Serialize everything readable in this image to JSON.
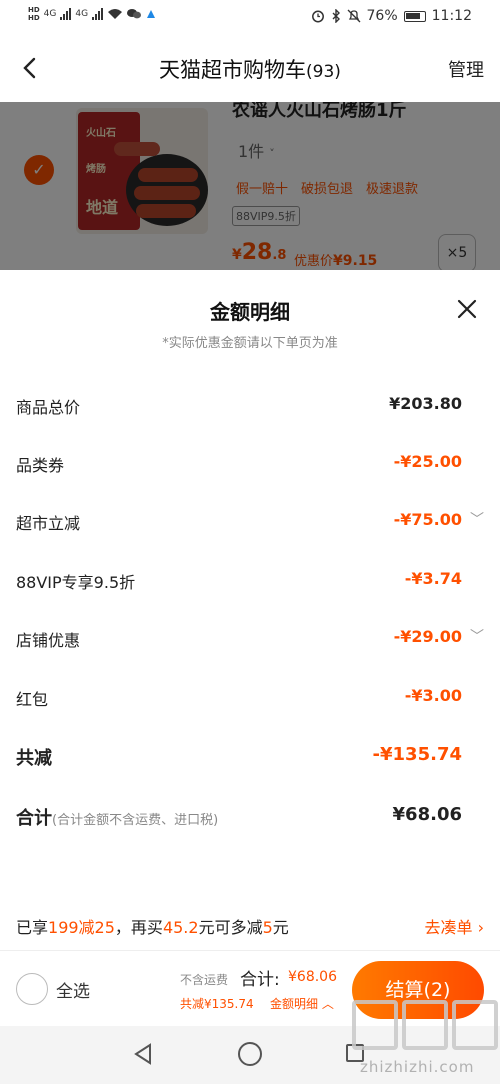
{
  "status_bar": {
    "hd1": "HD",
    "hd2": "HD",
    "net1": "4G",
    "net2": "4G",
    "battery": "76%",
    "time": "11:12"
  },
  "header": {
    "title": "天猫超市购物车",
    "count": "(93)",
    "manage": "管理"
  },
  "product": {
    "title": "农谣人火山石烤肠1斤",
    "quantity": "1件",
    "tags": [
      "假一赔十",
      "破损包退",
      "极速退款"
    ],
    "vip": "88VIP9.5折",
    "price_currency": "¥",
    "price_int": "28",
    "price_dec": ".8",
    "discount_label": "优惠价",
    "discount_price": "¥9.15",
    "count_badge": "×5",
    "package_text": [
      "火山石",
      "烤肠",
      "地道"
    ]
  },
  "sheet": {
    "title": "金额明细",
    "subtitle": "*实际优惠金额请以下单页为准",
    "rows": [
      {
        "label": "商品总价",
        "value": "¥203.80"
      },
      {
        "label": "品类券",
        "value": "-¥25.00"
      },
      {
        "label": "超市立减",
        "value": "-¥75.00"
      },
      {
        "label": "88VIP专享9.5折",
        "value": "-¥3.74"
      },
      {
        "label": "店铺优惠",
        "value": "-¥29.00"
      },
      {
        "label": "红包",
        "value": "-¥3.00"
      }
    ],
    "saved_label": "共减",
    "saved_value": "-¥135.74",
    "total_label": "合计",
    "total_note": "(合计金额不含运费、进口税)",
    "total_value": "¥68.06"
  },
  "promo": {
    "p1": "已享",
    "h1": "199减25",
    "p2": "，再买",
    "h2": "45.2",
    "p3": "元可多减",
    "h3": "5",
    "p4": "元",
    "link": "去凑单 ›"
  },
  "bottom_bar": {
    "select_all": "全选",
    "no_shipping": "不含运费",
    "total_label": "合计:",
    "total_amount": "¥68.06",
    "saved": "共减¥135.74",
    "detail_link": "金额明细 ︿",
    "checkout": "结算(2)"
  },
  "watermark": {
    "text": "zhizhizhi.com"
  },
  "colors": {
    "accent": "#ff5000",
    "checkout_start": "#ff7a00",
    "checkout_end": "#ff4a00"
  }
}
